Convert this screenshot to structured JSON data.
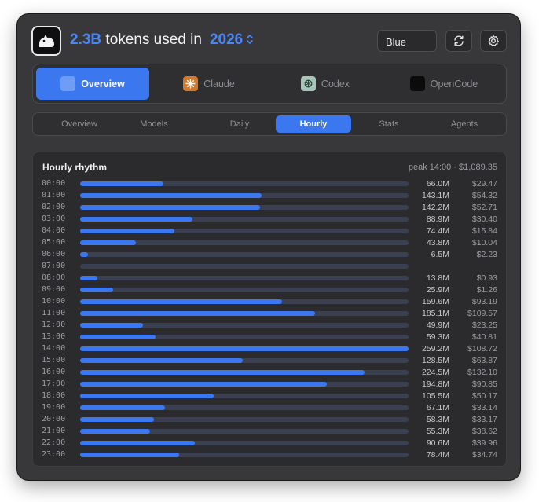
{
  "header": {
    "total_tokens": "2.3B",
    "tokens_used_in": " tokens used in",
    "year": "2026",
    "theme": "Blue",
    "icons": {
      "app": "cat-logo-icon",
      "refresh": "refresh-icon",
      "settings": "gear-icon",
      "year_chevron": "chevron-updown-icon"
    }
  },
  "providers": [
    {
      "label": "Overview",
      "icon": "overview-icon",
      "active": true
    },
    {
      "label": "Claude",
      "icon": "claude-icon",
      "active": false
    },
    {
      "label": "Codex",
      "icon": "codex-icon",
      "active": false
    },
    {
      "label": "OpenCode",
      "icon": "opencode-icon",
      "active": false
    }
  ],
  "tabs": [
    {
      "label": "Overview",
      "active": false
    },
    {
      "label": "Models",
      "active": false
    },
    {
      "label": "Daily",
      "active": false
    },
    {
      "label": "Hourly",
      "active": true
    },
    {
      "label": "Stats",
      "active": false
    },
    {
      "label": "Agents",
      "active": false
    }
  ],
  "colors": {
    "accent": "#3b78f0",
    "track": "#3a3f52",
    "claude": "#d4782a",
    "codex": "#a9c4b8"
  },
  "hourly": {
    "title": "Hourly rhythm",
    "peak": "peak 14:00 · $1,089.35",
    "rows": [
      {
        "hour": "00:00",
        "tokens": "66.0M",
        "cost": "$29.47",
        "value": 66.0
      },
      {
        "hour": "01:00",
        "tokens": "143.1M",
        "cost": "$54.32",
        "value": 143.1
      },
      {
        "hour": "02:00",
        "tokens": "142.2M",
        "cost": "$52.71",
        "value": 142.2
      },
      {
        "hour": "03:00",
        "tokens": "88.9M",
        "cost": "$30.40",
        "value": 88.9
      },
      {
        "hour": "04:00",
        "tokens": "74.4M",
        "cost": "$15.84",
        "value": 74.4
      },
      {
        "hour": "05:00",
        "tokens": "43.8M",
        "cost": "$10.04",
        "value": 43.8
      },
      {
        "hour": "06:00",
        "tokens": "6.5M",
        "cost": "$2.23",
        "value": 6.5
      },
      {
        "hour": "07:00",
        "tokens": "",
        "cost": "",
        "value": 0
      },
      {
        "hour": "08:00",
        "tokens": "13.8M",
        "cost": "$0.93",
        "value": 13.8
      },
      {
        "hour": "09:00",
        "tokens": "25.9M",
        "cost": "$1.26",
        "value": 25.9
      },
      {
        "hour": "10:00",
        "tokens": "159.6M",
        "cost": "$93.19",
        "value": 159.6
      },
      {
        "hour": "11:00",
        "tokens": "185.1M",
        "cost": "$109.57",
        "value": 185.1
      },
      {
        "hour": "12:00",
        "tokens": "49.9M",
        "cost": "$23.25",
        "value": 49.9
      },
      {
        "hour": "13:00",
        "tokens": "59.3M",
        "cost": "$40.81",
        "value": 59.3
      },
      {
        "hour": "14:00",
        "tokens": "259.2M",
        "cost": "$108.72",
        "value": 259.2
      },
      {
        "hour": "15:00",
        "tokens": "128.5M",
        "cost": "$63.87",
        "value": 128.5
      },
      {
        "hour": "16:00",
        "tokens": "224.5M",
        "cost": "$132.10",
        "value": 224.5
      },
      {
        "hour": "17:00",
        "tokens": "194.8M",
        "cost": "$90.85",
        "value": 194.8
      },
      {
        "hour": "18:00",
        "tokens": "105.5M",
        "cost": "$50.17",
        "value": 105.5
      },
      {
        "hour": "19:00",
        "tokens": "67.1M",
        "cost": "$33.14",
        "value": 67.1
      },
      {
        "hour": "20:00",
        "tokens": "58.3M",
        "cost": "$33.17",
        "value": 58.3
      },
      {
        "hour": "21:00",
        "tokens": "55.3M",
        "cost": "$38.62",
        "value": 55.3
      },
      {
        "hour": "22:00",
        "tokens": "90.6M",
        "cost": "$39.96",
        "value": 90.6
      },
      {
        "hour": "23:00",
        "tokens": "78.4M",
        "cost": "$34.74",
        "value": 78.4
      }
    ]
  }
}
